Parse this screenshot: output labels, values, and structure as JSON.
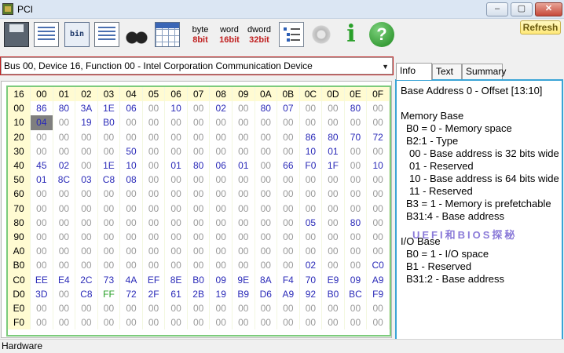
{
  "window": {
    "title": "PCI",
    "min": "–",
    "max": "▢",
    "close": "✕"
  },
  "toolbar": {
    "byte": {
      "top": "byte",
      "num": "8",
      "suffix": "bit"
    },
    "word": {
      "top": "word",
      "num": "16",
      "suffix": "bit"
    },
    "dword": {
      "top": "dword",
      "num": "32",
      "suffix": "bit"
    },
    "bin_label": "bin",
    "info_glyph": "i",
    "help_glyph": "?",
    "refresh": "Refresh"
  },
  "device": {
    "selected": "Bus 00, Device 16, Function 00 - Intel Corporation Communication Device",
    "arrow": "▼"
  },
  "grid": {
    "corner": "16",
    "columns": [
      "00",
      "01",
      "02",
      "03",
      "04",
      "05",
      "06",
      "07",
      "08",
      "09",
      "0A",
      "0B",
      "0C",
      "0D",
      "0E",
      "0F"
    ],
    "rows": [
      {
        "label": "00",
        "cells": [
          "86",
          "80",
          "3A",
          "1E",
          "06",
          "00",
          "10",
          "00",
          "02",
          "00",
          "80",
          "07",
          "00",
          "00",
          "80",
          "00"
        ]
      },
      {
        "label": "10",
        "cells": [
          "04",
          "00",
          "19",
          "B0",
          "00",
          "00",
          "00",
          "00",
          "00",
          "00",
          "00",
          "00",
          "00",
          "00",
          "00",
          "00"
        ]
      },
      {
        "label": "20",
        "cells": [
          "00",
          "00",
          "00",
          "00",
          "00",
          "00",
          "00",
          "00",
          "00",
          "00",
          "00",
          "00",
          "86",
          "80",
          "70",
          "72"
        ]
      },
      {
        "label": "30",
        "cells": [
          "00",
          "00",
          "00",
          "00",
          "50",
          "00",
          "00",
          "00",
          "00",
          "00",
          "00",
          "00",
          "10",
          "01",
          "00",
          "00"
        ]
      },
      {
        "label": "40",
        "cells": [
          "45",
          "02",
          "00",
          "1E",
          "10",
          "00",
          "01",
          "80",
          "06",
          "01",
          "00",
          "66",
          "F0",
          "1F",
          "00",
          "10"
        ]
      },
      {
        "label": "50",
        "cells": [
          "01",
          "8C",
          "03",
          "C8",
          "08",
          "00",
          "00",
          "00",
          "00",
          "00",
          "00",
          "00",
          "00",
          "00",
          "00",
          "00"
        ]
      },
      {
        "label": "60",
        "cells": [
          "00",
          "00",
          "00",
          "00",
          "00",
          "00",
          "00",
          "00",
          "00",
          "00",
          "00",
          "00",
          "00",
          "00",
          "00",
          "00"
        ]
      },
      {
        "label": "70",
        "cells": [
          "00",
          "00",
          "00",
          "00",
          "00",
          "00",
          "00",
          "00",
          "00",
          "00",
          "00",
          "00",
          "00",
          "00",
          "00",
          "00"
        ]
      },
      {
        "label": "80",
        "cells": [
          "00",
          "00",
          "00",
          "00",
          "00",
          "00",
          "00",
          "00",
          "00",
          "00",
          "00",
          "00",
          "05",
          "00",
          "80",
          "00"
        ]
      },
      {
        "label": "90",
        "cells": [
          "00",
          "00",
          "00",
          "00",
          "00",
          "00",
          "00",
          "00",
          "00",
          "00",
          "00",
          "00",
          "00",
          "00",
          "00",
          "00"
        ]
      },
      {
        "label": "A0",
        "cells": [
          "00",
          "00",
          "00",
          "00",
          "00",
          "00",
          "00",
          "00",
          "00",
          "00",
          "00",
          "00",
          "00",
          "00",
          "00",
          "00"
        ]
      },
      {
        "label": "B0",
        "cells": [
          "00",
          "00",
          "00",
          "00",
          "00",
          "00",
          "00",
          "00",
          "00",
          "00",
          "00",
          "00",
          "02",
          "00",
          "00",
          "C0"
        ]
      },
      {
        "label": "C0",
        "cells": [
          "EE",
          "E4",
          "2C",
          "73",
          "4A",
          "EF",
          "8E",
          "B0",
          "09",
          "9E",
          "8A",
          "F4",
          "70",
          "E9",
          "09",
          "A9"
        ]
      },
      {
        "label": "D0",
        "cells": [
          "3D",
          "00",
          "C8",
          "FF",
          "72",
          "2F",
          "61",
          "2B",
          "19",
          "B9",
          "D6",
          "A9",
          "92",
          "B0",
          "BC",
          "F9"
        ]
      },
      {
        "label": "E0",
        "cells": [
          "00",
          "00",
          "00",
          "00",
          "00",
          "00",
          "00",
          "00",
          "00",
          "00",
          "00",
          "00",
          "00",
          "00",
          "00",
          "00"
        ]
      },
      {
        "label": "F0",
        "cells": [
          "00",
          "00",
          "00",
          "00",
          "00",
          "00",
          "00",
          "00",
          "00",
          "00",
          "00",
          "00",
          "00",
          "00",
          "00",
          "00"
        ]
      }
    ],
    "selected_cell": "10:00",
    "colors": {
      "value": "#2a2ab8",
      "zero": "#9a9a9a",
      "header_bg": "#fffbd2",
      "border": "#7ccb7c",
      "special": "#2aa02a"
    }
  },
  "tabs": [
    "Info",
    "Text",
    "Summary"
  ],
  "info": {
    "lines": [
      "Base Address 0 - Offset [13:10]",
      "",
      "Memory Base",
      " B0 = 0 - Memory space",
      " B2:1 - Type",
      "   00 - Base address is 32 bits wide",
      "   01 - Reserved",
      "   10 - Base address is 64 bits wide",
      "   11 - Reserved",
      " B3 = 1 - Memory is prefetchable",
      " B31:4 - Base address",
      "",
      "I/O Base",
      " B0 = 1 - I/O space",
      " B1 - Reserved",
      " B31:2 - Base address"
    ],
    "watermark": "UEFI和BIOS探秘"
  },
  "status": "Hardware"
}
